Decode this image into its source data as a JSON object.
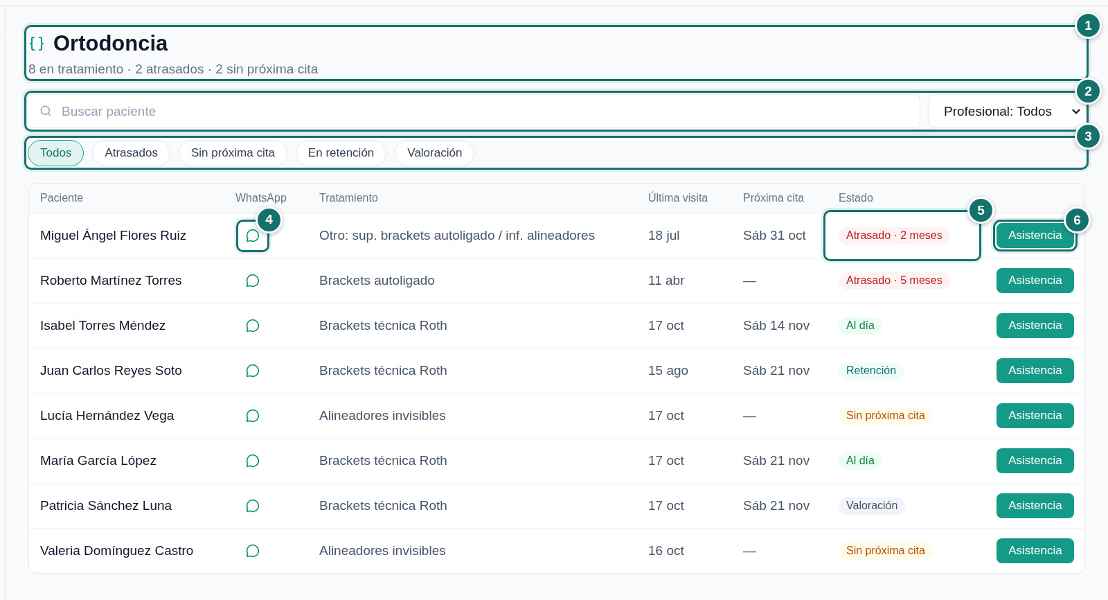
{
  "header": {
    "title": "Ortodoncia",
    "subtitle": "8 en tratamiento · 2 atrasados · 2 sin próxima cita",
    "callout": "1"
  },
  "search": {
    "placeholder": "Buscar paciente",
    "callout": "2"
  },
  "professional_select": {
    "value": "Profesional: Todos"
  },
  "filters": {
    "callout": "3",
    "chips": [
      {
        "label": "Todos",
        "selected": true
      },
      {
        "label": "Atrasados",
        "selected": false
      },
      {
        "label": "Sin próxima cita",
        "selected": false
      },
      {
        "label": "En retención",
        "selected": false
      },
      {
        "label": "Valoración",
        "selected": false
      }
    ]
  },
  "table": {
    "columns": [
      "Paciente",
      "WhatsApp",
      "Tratamiento",
      "Última visita",
      "Próxima cita",
      "Estado"
    ],
    "rows": [
      {
        "patient": "Miguel Ángel Flores Ruiz",
        "whatsapp": {
          "callout": "4"
        },
        "treatment": "Otro: sup. brackets autoligado / inf. alineadores",
        "last_visit": "18 jul",
        "next_appointment": "Sáb 31 oct",
        "status": {
          "kind": "overdue",
          "label": "Atrasado · 2 meses",
          "callout": "5"
        },
        "action": {
          "label": "Asistencia",
          "callout": "6"
        }
      },
      {
        "patient": "Roberto Martínez Torres",
        "treatment": "Brackets autoligado",
        "last_visit": "11 abr",
        "next_appointment": "—",
        "status": {
          "kind": "overdue",
          "label": "Atrasado · 5 meses"
        },
        "action": {
          "label": "Asistencia"
        }
      },
      {
        "patient": "Isabel Torres Méndez",
        "treatment": "Brackets técnica Roth",
        "last_visit": "17 oct",
        "next_appointment": "Sáb 14 nov",
        "status": {
          "kind": "on_track",
          "label": "Al día"
        },
        "action": {
          "label": "Asistencia"
        }
      },
      {
        "patient": "Juan Carlos Reyes Soto",
        "treatment": "Brackets técnica Roth",
        "last_visit": "15 ago",
        "next_appointment": "Sáb 21 nov",
        "status": {
          "kind": "retention",
          "label": "Retención"
        },
        "action": {
          "label": "Asistencia"
        }
      },
      {
        "patient": "Lucía Hernández Vega",
        "treatment": "Alineadores invisibles",
        "last_visit": "17 oct",
        "next_appointment": "—",
        "status": {
          "kind": "no_appointment",
          "label": "Sin próxima cita"
        },
        "action": {
          "label": "Asistencia"
        }
      },
      {
        "patient": "María García López",
        "treatment": "Brackets técnica Roth",
        "last_visit": "17 oct",
        "next_appointment": "Sáb 21 nov",
        "status": {
          "kind": "on_track",
          "label": "Al día"
        },
        "action": {
          "label": "Asistencia"
        }
      },
      {
        "patient": "Patricia Sánchez Luna",
        "treatment": "Brackets técnica Roth",
        "last_visit": "17 oct",
        "next_appointment": "Sáb 21 nov",
        "status": {
          "kind": "assessment",
          "label": "Valoración"
        },
        "action": {
          "label": "Asistencia"
        }
      },
      {
        "patient": "Valeria Domínguez Castro",
        "treatment": "Alineadores invisibles",
        "last_visit": "16 oct",
        "next_appointment": "—",
        "status": {
          "kind": "no_appointment",
          "label": "Sin próxima cita"
        },
        "action": {
          "label": "Asistencia"
        }
      }
    ]
  }
}
